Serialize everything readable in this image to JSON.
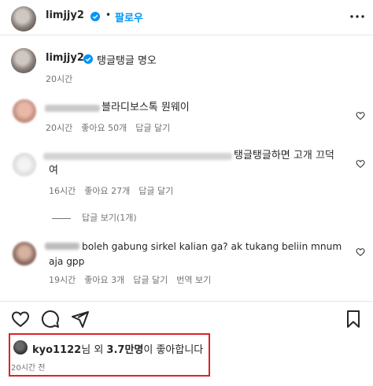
{
  "post": {
    "author": "limjjy2",
    "follow_label": "팔로우",
    "dot": "•"
  },
  "caption": {
    "username": "limjjy2",
    "text": "탱글탱글 명오",
    "time": "20시간"
  },
  "comments": [
    {
      "text": "블라디보스톡 뭔웨이",
      "time": "20시간",
      "likes": "좋아요 50개",
      "reply": "답글 달기"
    },
    {
      "text_line1": "탱글탱글하면 고개 끄덕",
      "text_line2": "여",
      "time": "16시간",
      "likes": "좋아요 27개",
      "reply": "답글 달기",
      "view_replies": "답글 보기(1개)"
    },
    {
      "text_line1": "boleh gabung sirkel kalian ga? ak tukang beliin mnum",
      "text_line2": "aja gpp",
      "time": "19시간",
      "likes": "좋아요 3개",
      "reply": "답글 달기",
      "translate": "번역 보기"
    }
  ],
  "footer": {
    "liker": "kyo1122",
    "liker_suffix": "님 외 ",
    "count": "3.7만명",
    "tail": "이 좋아합니다",
    "time": "20시간 전"
  },
  "colors": {
    "accent": "#0095f6",
    "highlight_box": "#d9232a",
    "muted": "#737373"
  },
  "icons": [
    "verified-badge-icon",
    "more-options-icon",
    "heart-icon",
    "comment-icon",
    "share-icon",
    "bookmark-icon"
  ]
}
